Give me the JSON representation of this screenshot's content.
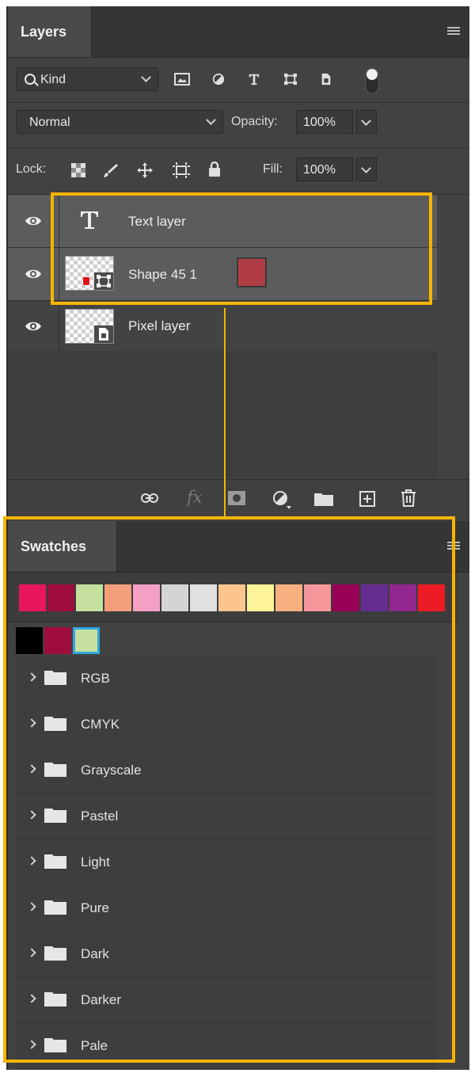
{
  "layers_panel": {
    "tab_label": "Layers",
    "filter": {
      "label": "Kind"
    },
    "blend_mode": "Normal",
    "opacity_label": "Opacity:",
    "opacity_value": "100%",
    "lock_label": "Lock:",
    "fill_label": "Fill:",
    "fill_value": "100%",
    "layers": [
      {
        "name": "Text layer",
        "type": "text",
        "visible": true,
        "selected": true
      },
      {
        "name": "Shape 45 1",
        "type": "shape",
        "visible": true,
        "selected": true,
        "fill_color": "#b03c46"
      },
      {
        "name": "Pixel layer",
        "type": "pixel",
        "visible": true,
        "selected": false
      }
    ]
  },
  "swatches_panel": {
    "tab_label": "Swatches",
    "colors": [
      "#e8175d",
      "#9e0d3c",
      "#c6e09f",
      "#f49f7b",
      "#f4a0c4",
      "#d4d4d4",
      "#e0e0e0",
      "#fcc58d",
      "#fef49a",
      "#f9b080",
      "#f5979a",
      "#980055",
      "#662d91",
      "#92278f",
      "#ed1c24"
    ],
    "recent_colors": [
      "#000000",
      "#9e0d3c",
      "#c6e09f"
    ],
    "groups": [
      "RGB",
      "CMYK",
      "Grayscale",
      "Pastel",
      "Light",
      "Pure",
      "Dark",
      "Darker",
      "Pale"
    ]
  },
  "highlight_color": "#f5b400"
}
